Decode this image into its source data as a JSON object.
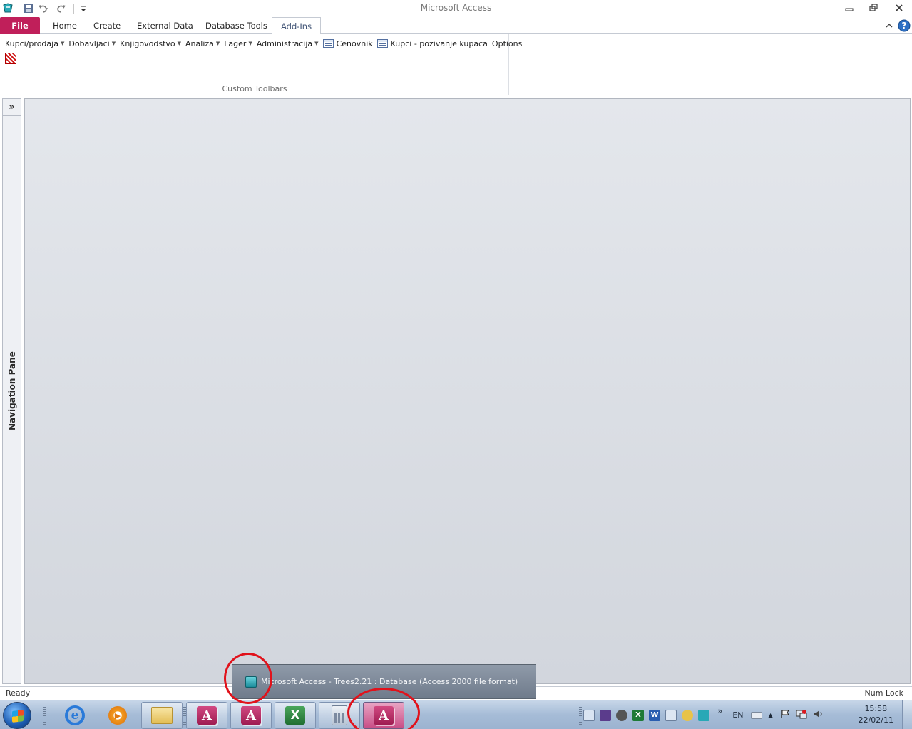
{
  "window": {
    "title": "Microsoft Access"
  },
  "tabs": {
    "file": "File",
    "home": "Home",
    "create": "Create",
    "external_data": "External Data",
    "database_tools": "Database Tools",
    "add_ins": "Add-Ins"
  },
  "ribbon": {
    "menus": [
      {
        "label": "Kupci/prodaja"
      },
      {
        "label": "Dobavljaci"
      },
      {
        "label": "Knjigovodstvo"
      },
      {
        "label": "Analiza"
      },
      {
        "label": "Lager"
      },
      {
        "label": "Administracija"
      }
    ],
    "buttons": [
      {
        "label": "Cenovnik"
      },
      {
        "label": "Kupci - pozivanje kupaca"
      },
      {
        "label": "Options"
      }
    ],
    "group_label": "Custom Toolbars"
  },
  "nav_pane": {
    "label": "Navigation Pane",
    "toggle": "»"
  },
  "status": {
    "left": "Ready",
    "right": "Num Lock"
  },
  "taskbar": {
    "thumbnail_title": "Microsoft Access - Trees2.21 : Database (Access 2000 file format)",
    "language": "EN",
    "time": "15:58",
    "date": "22/02/11",
    "overflow": "»"
  },
  "colors": {
    "file_tab": "#c01f5a",
    "annotation": "#e1121b",
    "doc_background": "#dde0e6"
  },
  "icons": [
    "app-icon",
    "save-icon",
    "undo-icon",
    "redo-icon",
    "customize-qat-icon",
    "minimize-icon",
    "restore-icon",
    "close-icon",
    "ribbon-collapse-icon",
    "help-icon",
    "form-icon",
    "toolbar-button-icon",
    "windows-start-icon",
    "internet-explorer-icon",
    "media-player-icon",
    "explorer-folder-icon",
    "access-icon",
    "excel-icon",
    "calculator-icon"
  ]
}
